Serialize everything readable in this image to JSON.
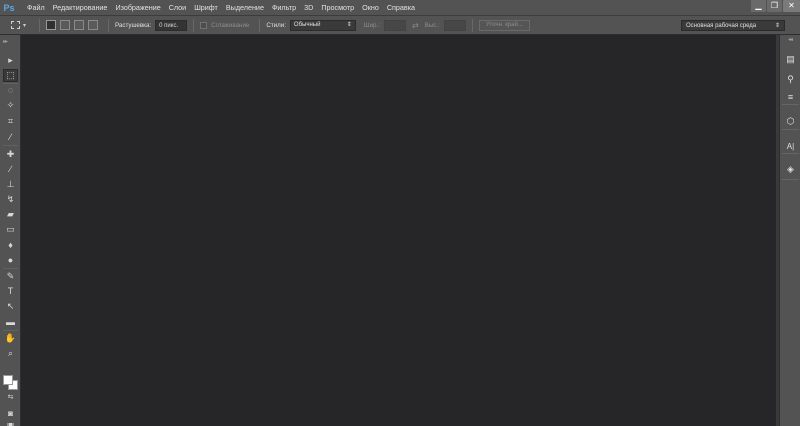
{
  "app": {
    "logo": "Ps",
    "accent_color": "#5ba8e6"
  },
  "menu": {
    "items": [
      "Файл",
      "Редактирование",
      "Изображение",
      "Слои",
      "Шрифт",
      "Выделение",
      "Фильтр",
      "3D",
      "Просмотр",
      "Окно",
      "Справка"
    ]
  },
  "window_controls": {
    "minimize": "▁",
    "restore": "❐",
    "close": "✕"
  },
  "options": {
    "feather_label": "Растушевка:",
    "feather_value": "0 пикс.",
    "antialias_label": "Сглаживание",
    "style_label": "Стили:",
    "style_value": "Обычный",
    "width_label": "Шир.:",
    "height_label": "Выс.:",
    "refine_edge": "Уточн. край...",
    "workspace": "Основная рабочая среда"
  },
  "tools": [
    {
      "name": "move-tool-icon",
      "glyph": "▸"
    },
    {
      "name": "rect-marquee-tool-icon",
      "glyph": "⬚"
    },
    {
      "name": "lasso-tool-icon",
      "glyph": "◌"
    },
    {
      "name": "quick-selection-tool-icon",
      "glyph": "✧"
    },
    {
      "name": "crop-tool-icon",
      "glyph": "⌗"
    },
    {
      "name": "eyedropper-tool-icon",
      "glyph": "⁄"
    },
    {
      "name": "healing-brush-tool-icon",
      "glyph": "✚"
    },
    {
      "name": "brush-tool-icon",
      "glyph": "∕"
    },
    {
      "name": "clone-stamp-tool-icon",
      "glyph": "⊥"
    },
    {
      "name": "history-brush-tool-icon",
      "glyph": "↯"
    },
    {
      "name": "eraser-tool-icon",
      "glyph": "▰"
    },
    {
      "name": "gradient-tool-icon",
      "glyph": "▭"
    },
    {
      "name": "blur-tool-icon",
      "glyph": "♦"
    },
    {
      "name": "dodge-tool-icon",
      "glyph": "●"
    },
    {
      "name": "pen-tool-icon",
      "glyph": "✎"
    },
    {
      "name": "type-tool-icon",
      "glyph": "T"
    },
    {
      "name": "path-selection-tool-icon",
      "glyph": "↖"
    },
    {
      "name": "rectangle-tool-icon",
      "glyph": "▬"
    },
    {
      "name": "hand-tool-icon",
      "glyph": "✋"
    },
    {
      "name": "zoom-tool-icon",
      "glyph": "⌕"
    }
  ],
  "swatches": {
    "foreground": "#ffffff",
    "background": "#ffffff"
  },
  "dock": [
    {
      "name": "history-panel-icon",
      "glyph": "▤"
    },
    {
      "name": "brush-panel-icon",
      "glyph": "⚲"
    },
    {
      "name": "adjustments-panel-icon",
      "glyph": "≡"
    },
    {
      "name": "3d-panel-icon",
      "glyph": "⬡"
    },
    {
      "name": "character-panel-icon",
      "glyph": "A|"
    },
    {
      "name": "layers-panel-icon",
      "glyph": "◈"
    }
  ]
}
